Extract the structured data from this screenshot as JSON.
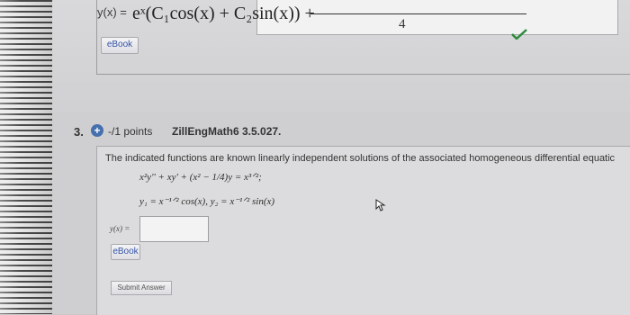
{
  "top_answer": {
    "label": "y(x) =",
    "expression": "eˣ(C₁cos(x) + C₂sin(x)) +",
    "fraction_denominator": "4",
    "status_icon": "check-icon",
    "status_color": "#2e8b3e",
    "ebook_label": "eBook"
  },
  "question": {
    "number": "3.",
    "points": "-/1 points",
    "reference": "ZillEngMath6 3.5.027.",
    "prompt": "The indicated functions are known linearly independent solutions of the associated homogeneous differential equatic",
    "equation": "x²y'' + xy' + (x² − 1/4)y = x³ᐟ²;",
    "solutions": "y₁ = x⁻¹ᐟ² cos(x), y₂ = x⁻¹ᐟ² sin(x)",
    "answer_label": "y(x) =",
    "answer_value": "",
    "ebook_label": "eBook",
    "submit_label": "Submit Answer"
  }
}
